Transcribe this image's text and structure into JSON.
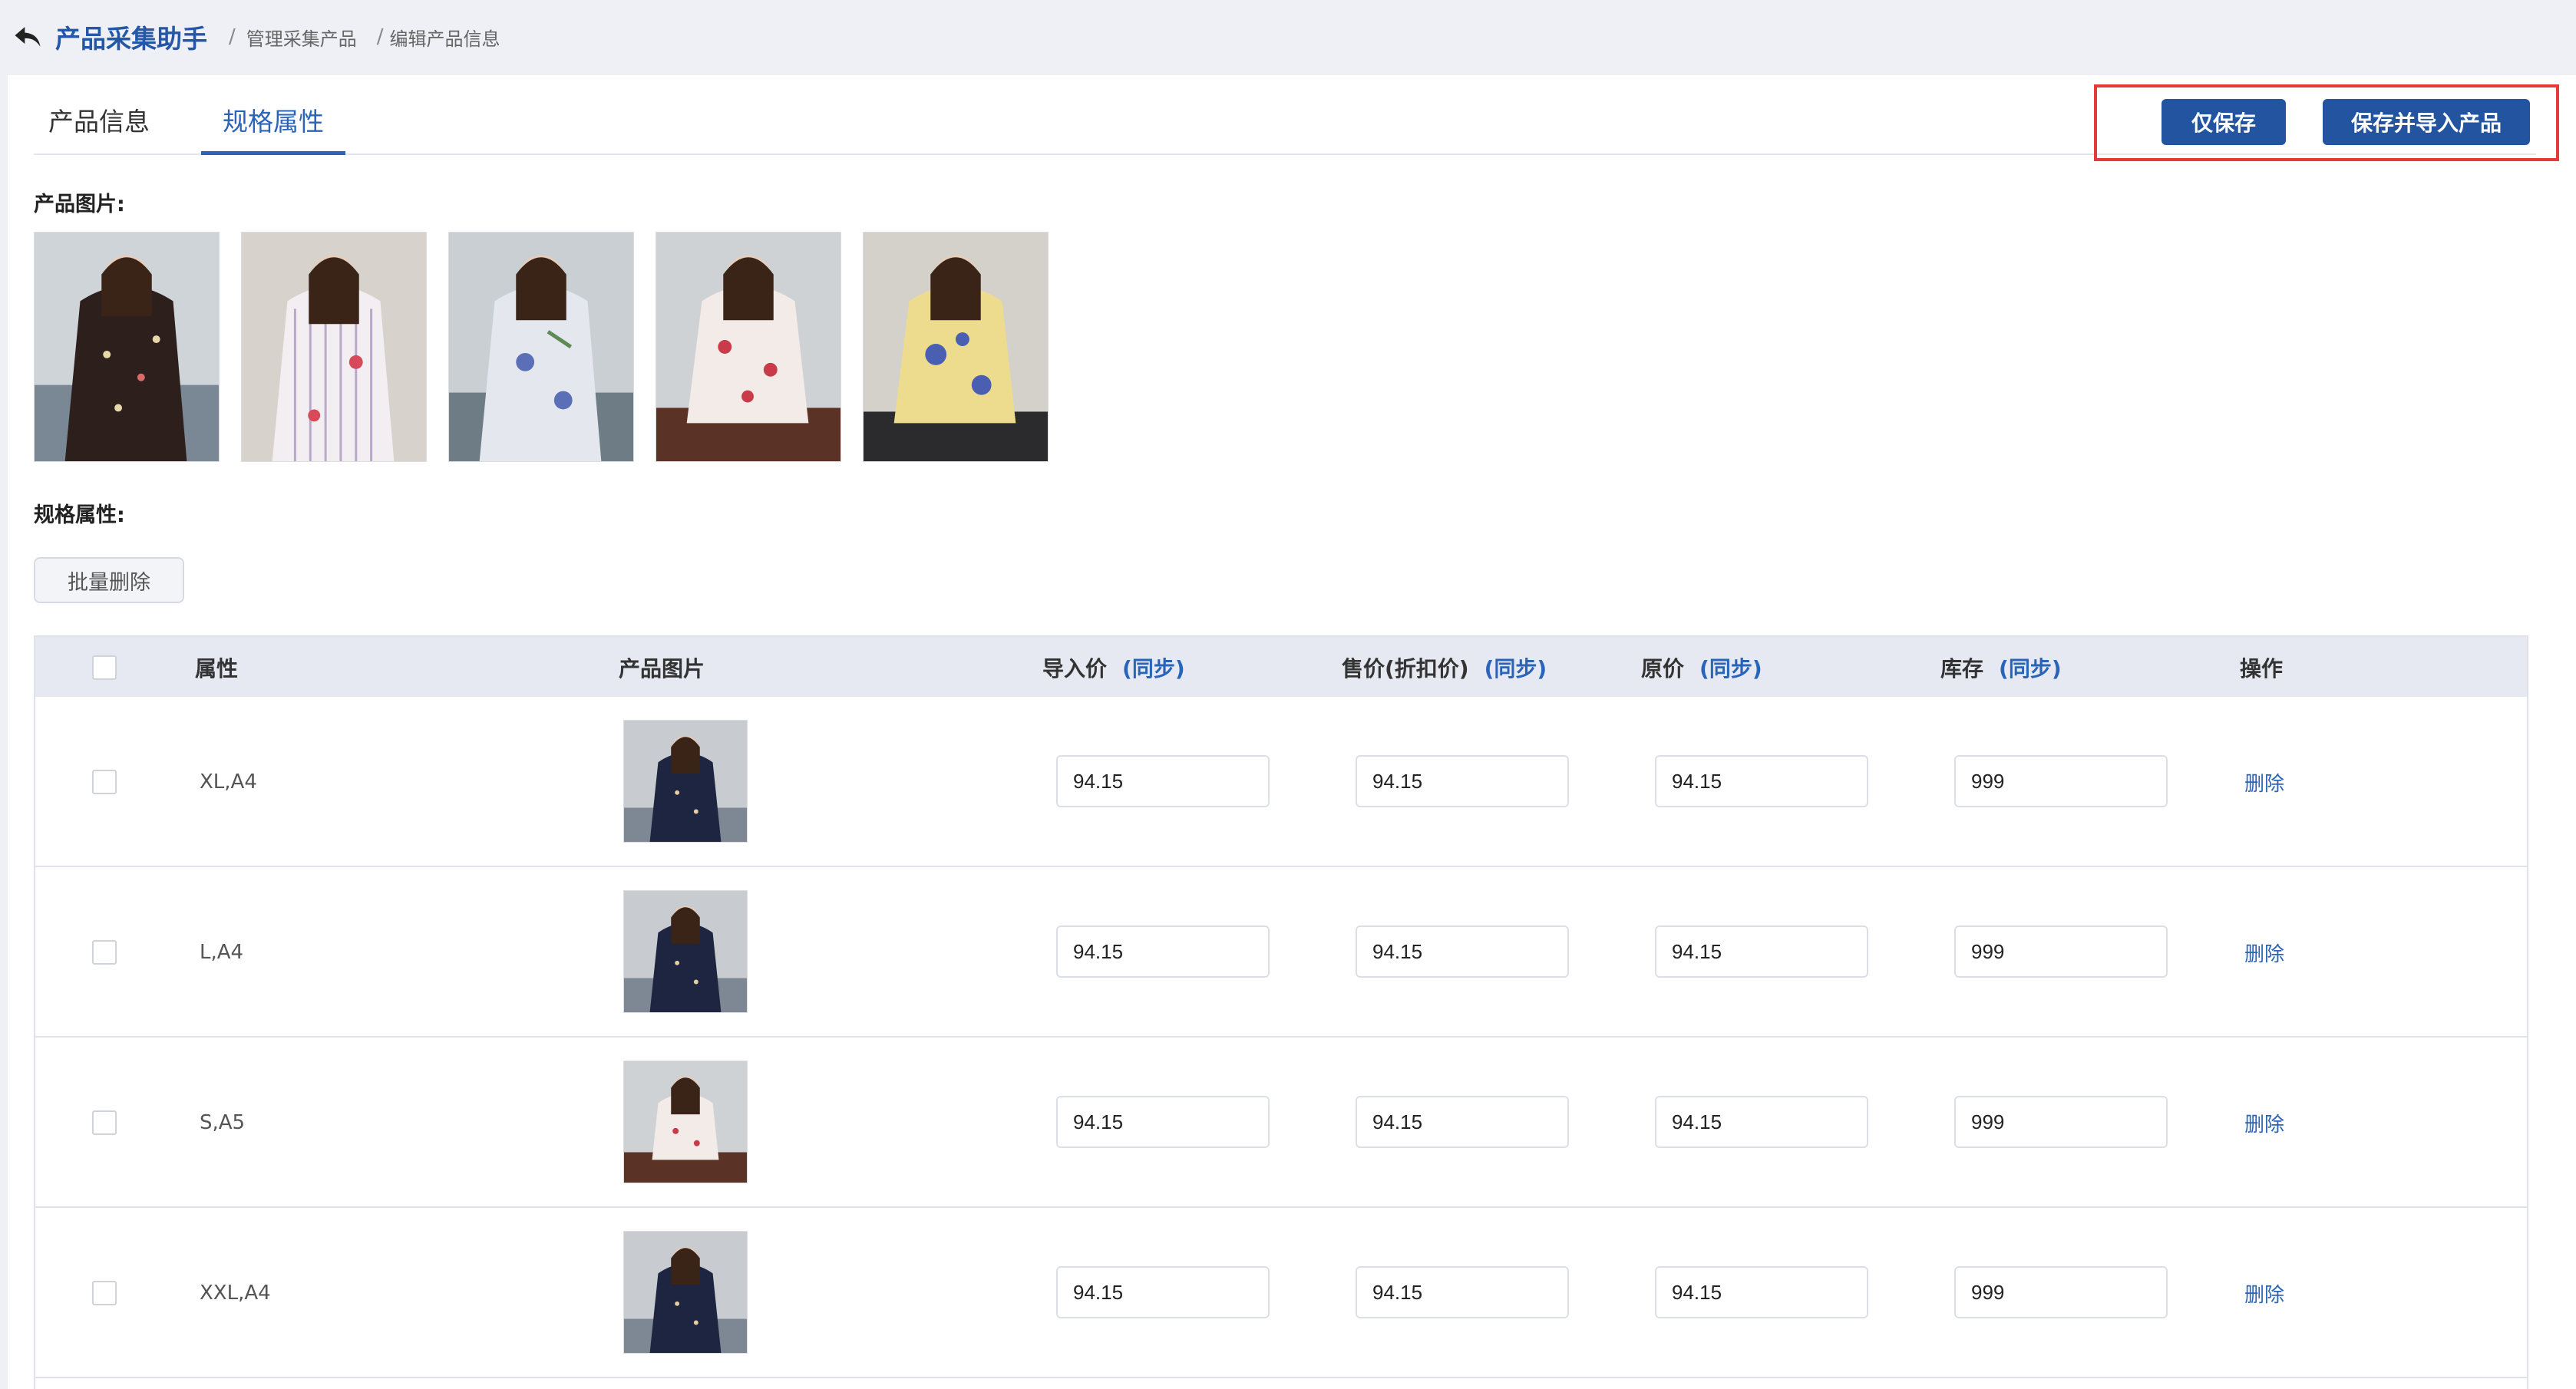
{
  "header": {
    "title": "产品采集助手",
    "breadcrumb": [
      "管理采集产品",
      "编辑产品信息"
    ]
  },
  "tabs": [
    {
      "label": "产品信息",
      "active": false
    },
    {
      "label": "规格属性",
      "active": true
    }
  ],
  "actions": {
    "save_label": "仅保存",
    "save_import_label": "保存并导入产品"
  },
  "product_images": {
    "label": "产品图片:",
    "items": [
      {
        "icon": "product-photo-black-floral",
        "color": "#3a2a26"
      },
      {
        "icon": "product-photo-white-stripe",
        "color": "#e8e3e8"
      },
      {
        "icon": "product-photo-blue-floral",
        "color": "#dfe3ea"
      },
      {
        "icon": "product-photo-white-red-floral",
        "color": "#efe6e4"
      },
      {
        "icon": "product-photo-yellow-floral",
        "color": "#efe2a8"
      }
    ]
  },
  "spec": {
    "label": "规格属性:",
    "batch_delete_label": "批量删除"
  },
  "table": {
    "columns": {
      "attribute": "属性",
      "image": "产品图片",
      "import_price": "导入价",
      "sale_price": "售价(折扣价)",
      "original_price": "原价",
      "stock": "库存",
      "operation": "操作",
      "sync": "(同步)"
    },
    "rows": [
      {
        "attribute": "XL,A4",
        "import_price": "94.15",
        "sale_price": "94.15",
        "original_price": "94.15",
        "stock": "999",
        "action": "删除",
        "icon": "product-photo-navy-floral"
      },
      {
        "attribute": "L,A4",
        "import_price": "94.15",
        "sale_price": "94.15",
        "original_price": "94.15",
        "stock": "999",
        "action": "删除",
        "icon": "product-photo-navy-floral"
      },
      {
        "attribute": "S,A5",
        "import_price": "94.15",
        "sale_price": "94.15",
        "original_price": "94.15",
        "stock": "999",
        "action": "删除",
        "icon": "product-photo-white-red-floral"
      },
      {
        "attribute": "XXL,A4",
        "import_price": "94.15",
        "sale_price": "94.15",
        "original_price": "94.15",
        "stock": "999",
        "action": "删除",
        "icon": "product-photo-navy-floral"
      }
    ]
  },
  "colors": {
    "primary": "#23549f",
    "link": "#2a64b8",
    "highlight": "#e33a3a"
  }
}
